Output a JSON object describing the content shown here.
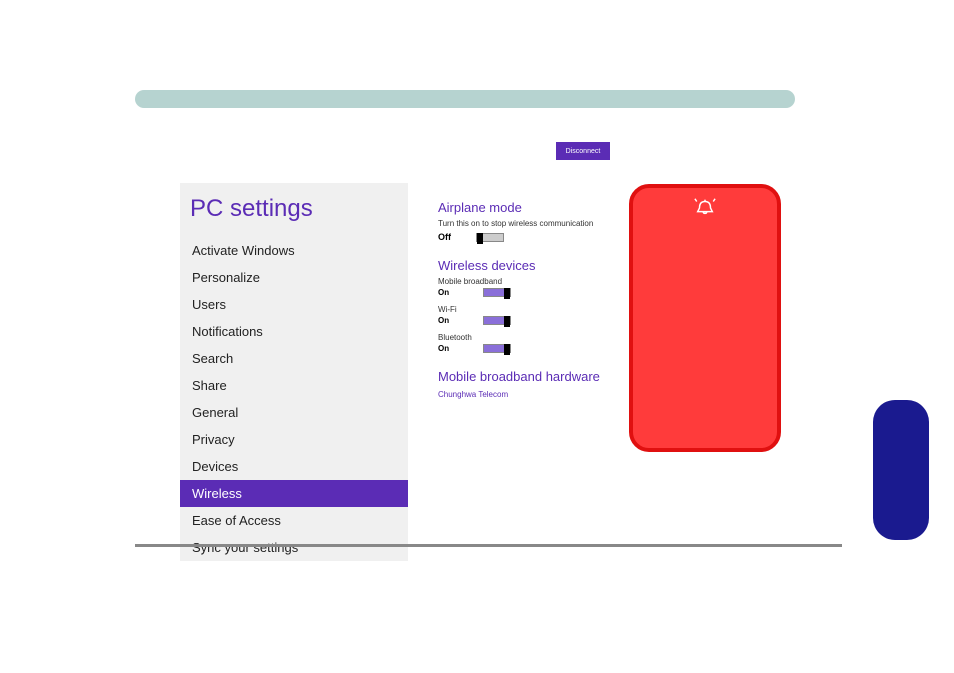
{
  "disconnect_label": "Disconnect",
  "sidebar": {
    "title": "PC settings",
    "items": [
      {
        "label": "Activate Windows"
      },
      {
        "label": "Personalize"
      },
      {
        "label": "Users"
      },
      {
        "label": "Notifications"
      },
      {
        "label": "Search"
      },
      {
        "label": "Share"
      },
      {
        "label": "General"
      },
      {
        "label": "Privacy"
      },
      {
        "label": "Devices"
      },
      {
        "label": "Wireless"
      },
      {
        "label": "Ease of Access"
      },
      {
        "label": "Sync your settings"
      }
    ],
    "active_index": 9
  },
  "content": {
    "airplane": {
      "title": "Airplane mode",
      "desc": "Turn this on to stop wireless communication",
      "state": "Off"
    },
    "wireless": {
      "title": "Wireless devices",
      "devices": [
        {
          "name": "Mobile broadband",
          "state": "On"
        },
        {
          "name": "Wi-Fi",
          "state": "On"
        },
        {
          "name": "Bluetooth",
          "state": "On"
        }
      ]
    },
    "mobile_hardware": {
      "title": "Mobile broadband hardware",
      "provider": "Chunghwa Telecom"
    }
  }
}
